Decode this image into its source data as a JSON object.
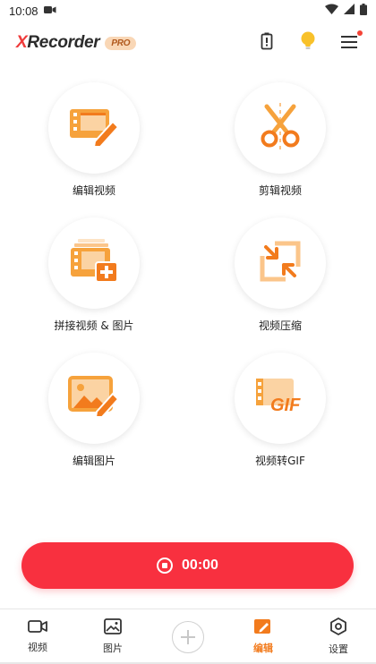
{
  "status_bar": {
    "time": "10:08"
  },
  "header": {
    "logo_x": "X",
    "logo_rest": "Recorder",
    "pro_badge": "PRO"
  },
  "tools": [
    {
      "label": "编辑视频",
      "icon": "edit-video-icon"
    },
    {
      "label": "剪辑视频",
      "icon": "scissors-icon"
    },
    {
      "label": "拼接视频 & 图片",
      "icon": "merge-video-icon"
    },
    {
      "label": "视频压缩",
      "icon": "compress-icon"
    },
    {
      "label": "编辑图片",
      "icon": "edit-image-icon"
    },
    {
      "label": "视频转GIF",
      "icon": "video-to-gif-icon"
    }
  ],
  "gif_text": "GIF",
  "record": {
    "time": "00:00"
  },
  "nav": [
    {
      "label": "视频",
      "icon": "video-camera-icon"
    },
    {
      "label": "图片",
      "icon": "image-icon"
    },
    {
      "label": "",
      "icon": "plus-icon"
    },
    {
      "label": "编辑",
      "icon": "edit-icon",
      "active": true
    },
    {
      "label": "设置",
      "icon": "settings-icon"
    }
  ],
  "colors": {
    "accent_orange": "#f27b1d",
    "record_red": "#f8303f",
    "logo_red": "#ef3b3b"
  }
}
